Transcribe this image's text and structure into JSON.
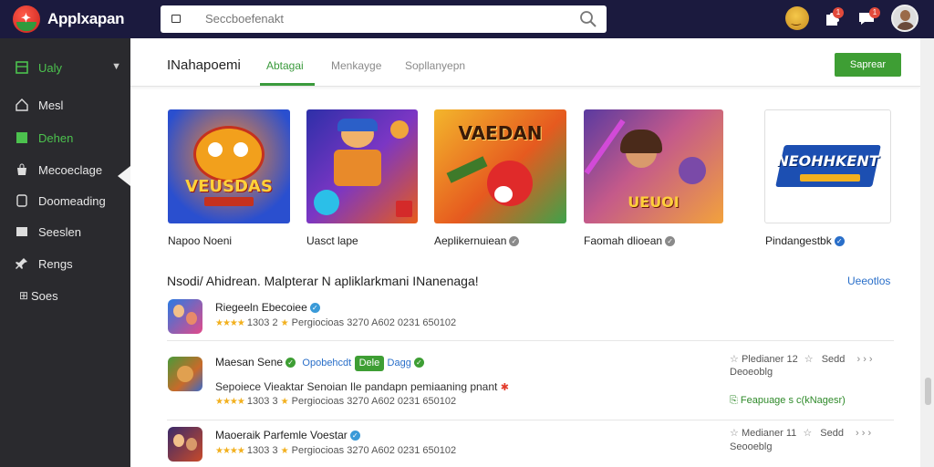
{
  "app": {
    "title": "Applxapan",
    "search_placeholder": "Seccboefenakt",
    "notif_badges": [
      "1",
      "1"
    ]
  },
  "sidebar": {
    "items": [
      {
        "label": "Ualy",
        "icon": "grid-icon"
      },
      {
        "label": "Mesl",
        "icon": "home-icon"
      },
      {
        "label": "Dehen",
        "icon": "category-icon"
      },
      {
        "label": "Mecoeclage",
        "icon": "bag-icon"
      },
      {
        "label": "Doomeading",
        "icon": "phone-icon"
      },
      {
        "label": "Seeslen",
        "icon": "image-icon"
      },
      {
        "label": "Rengs",
        "icon": "pin-icon"
      },
      {
        "label": "Soes",
        "icon": "stack-icon"
      }
    ],
    "active_index": 2
  },
  "header": {
    "title": "INahapoemi",
    "tabs": [
      "Abtagai",
      "Menkayge",
      "Sopllanyepn"
    ],
    "active_tab": 0,
    "action_label": "Saprear"
  },
  "featured": [
    {
      "name": "Napoo Noeni",
      "art_text": "VEUSDAS",
      "verified": false
    },
    {
      "name": "Uasct lape",
      "art_text": "",
      "verified": false
    },
    {
      "name": "Aeplikernuiean",
      "art_text": "VAEDAN",
      "verified": true
    },
    {
      "name": "Faomah dlioean",
      "art_text": "UEUOI",
      "verified": true
    },
    {
      "name": "Pindangestbk",
      "art_text": "NEOHHKENT",
      "verified": true,
      "verified_color": "#2a6fc9"
    }
  ],
  "list": {
    "title": "Nsodi/ Ahidrean. Malpterar N apliklarkmani INanenaga!",
    "see_all": "Ueeotlos",
    "rows": [
      {
        "name": "Riegeeln Ebecoiee",
        "rating": "1303 2",
        "meta": "Pergiocioas 3270 A602 0231 650102"
      },
      {
        "name": "Maesan Sene",
        "link_text": "Opobehcdt",
        "chip": "Dele",
        "link_text_2": "Dagg",
        "description": "Sepoiece Vieaktar Senoian Ile pandapn pemiaaning pnant",
        "rating": "1303 3",
        "meta": "Pergiocioas 3270 A602 0231 650102",
        "side_title": "Pledianer 12",
        "side_action": "Sedd",
        "side_sub": "Deoeoblg",
        "side_link": "Feapuage s c(kNagesr)"
      },
      {
        "name": "Maoeraik Parfemle Voestar",
        "rating": "1303 3",
        "meta": "Pergiocioas 3270 A602 0231 650102",
        "side_title": "Medianer 11",
        "side_action": "Sedd",
        "side_sub": "Seooeblg"
      }
    ]
  },
  "colors": {
    "topbar": "#1b1a3e",
    "sidebar": "#2a2a2e",
    "accent_green": "#3e9e34",
    "link_blue": "#2a6fc9"
  }
}
